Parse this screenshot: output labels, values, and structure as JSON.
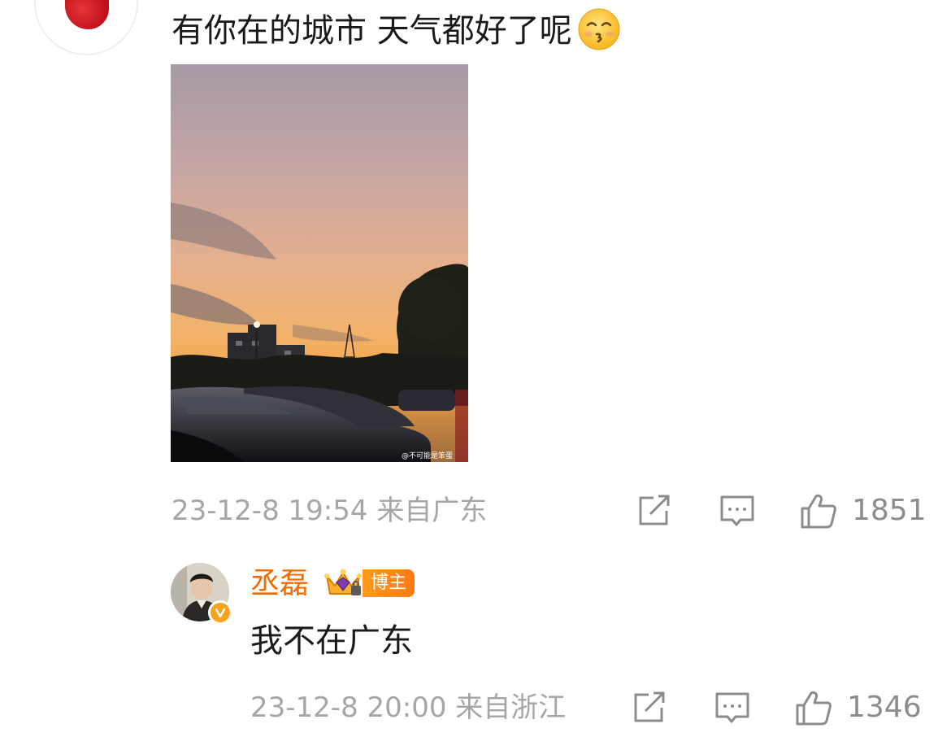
{
  "comment": {
    "text": "有你在的城市 天气都好了呢",
    "emoji": "kissing-face-emoji",
    "photo_watermark": "@不可能是笨蛋",
    "time": "23-12-8 19:54",
    "location": "来自广东",
    "like_count": "1851"
  },
  "reply": {
    "author": "丞磊",
    "tag": "博主",
    "text": "我不在广东",
    "time": "23-12-8 20:00",
    "location": "来自浙江",
    "like_count": "1346"
  },
  "colors": {
    "author_orange": "#f56a00",
    "meta_gray": "#a6a6a6",
    "verified_yellow": "#f7a31c",
    "tag_orange": "#ff8a17"
  },
  "icons": [
    "share-icon",
    "comment-icon",
    "like-icon",
    "verified-badge-icon",
    "crown-icon"
  ]
}
